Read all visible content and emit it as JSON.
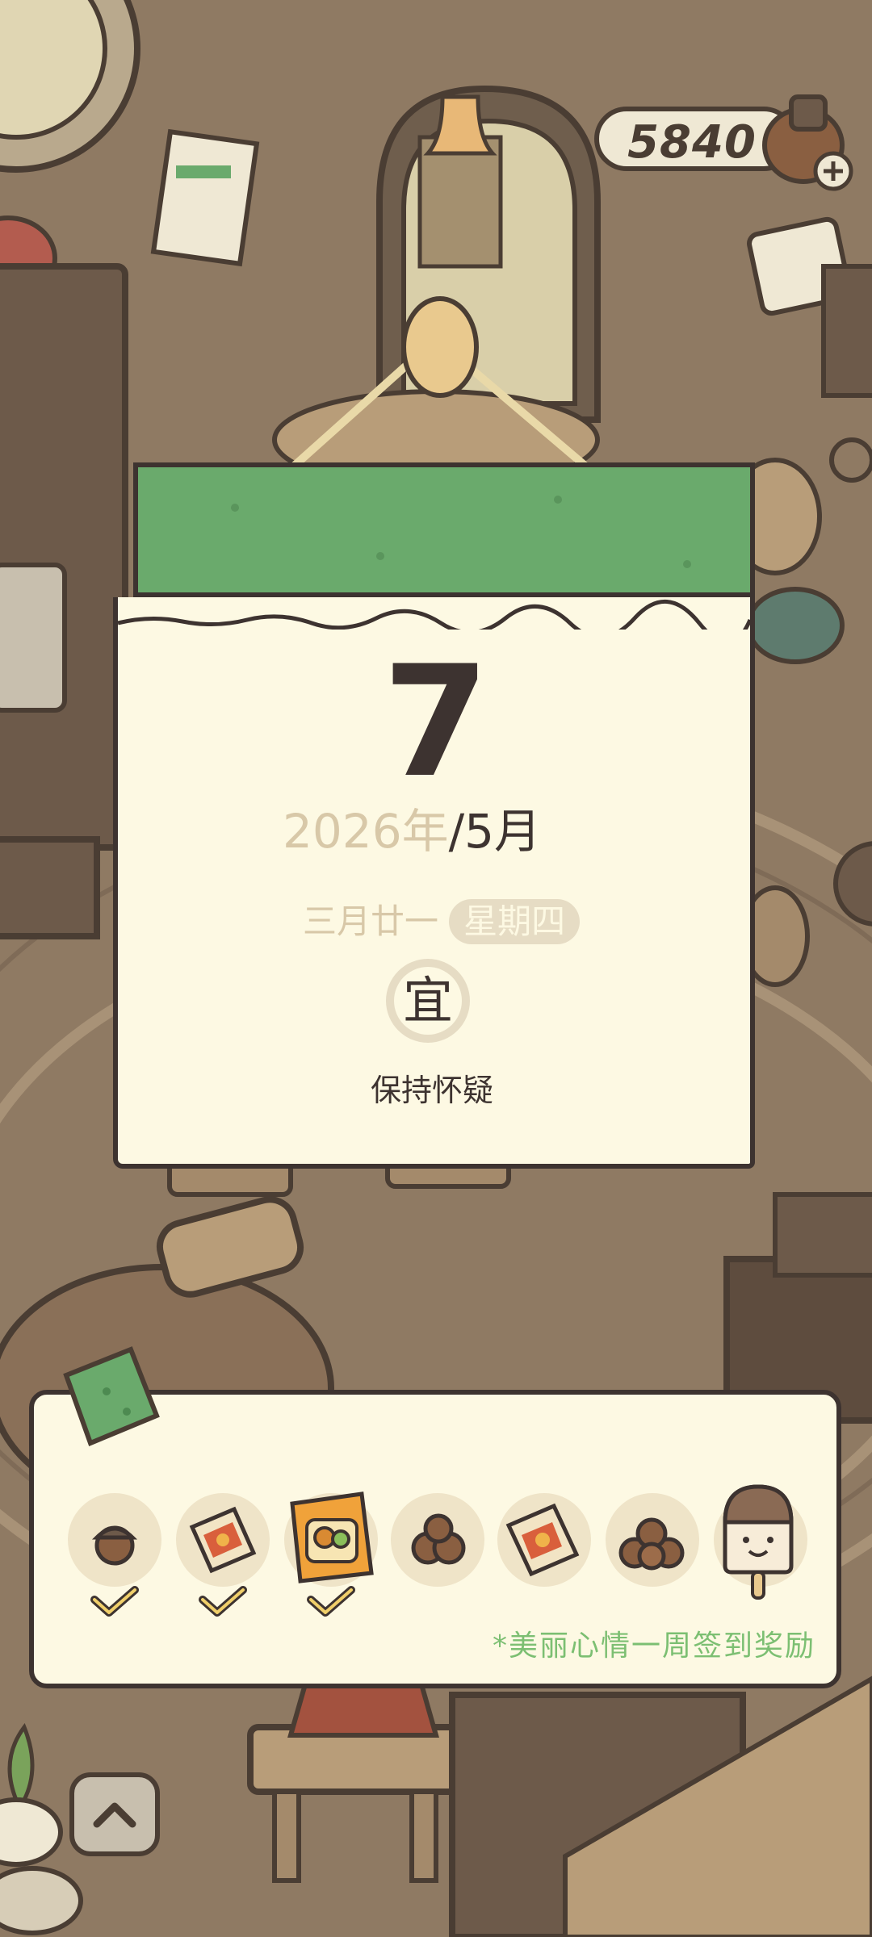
{
  "currency": {
    "amount": "5840"
  },
  "calendar": {
    "day": "7",
    "year": "2026年",
    "month": "/5月",
    "lunar_date": "三月廿一",
    "weekday": "星期四",
    "yi_label": "宜",
    "advice": "保持怀疑"
  },
  "reward": {
    "caption": "*美丽心情一周签到奖励",
    "days": [
      {
        "icon": "acorn-icon",
        "claimed": true
      },
      {
        "icon": "snack-bag-icon",
        "claimed": true
      },
      {
        "icon": "cookie-bag-icon",
        "claimed": true
      },
      {
        "icon": "acorns-icon",
        "claimed": false
      },
      {
        "icon": "snack-bag-icon",
        "claimed": false
      },
      {
        "icon": "acorn-pile-icon",
        "claimed": false
      },
      {
        "icon": "popsicle-icon",
        "claimed": false
      }
    ]
  },
  "colors": {
    "calendar_green": "#6aaa6c",
    "paper": "#fdf9e3",
    "outline": "#3d3330",
    "reward_text": "#7cbf72"
  }
}
